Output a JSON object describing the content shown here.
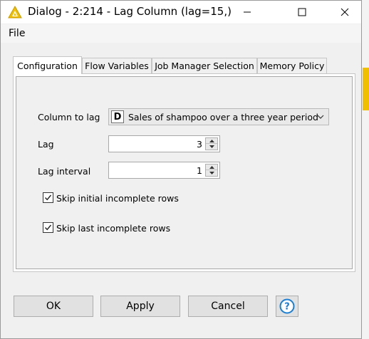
{
  "window": {
    "title": "Dialog - 2:214 - Lag Column (lag=15,)",
    "app_icon": "knime-triangle-icon",
    "accent_color": "#f0c000",
    "controls": [
      "minimize-icon",
      "maximize-icon",
      "close-icon"
    ]
  },
  "menu": {
    "file": "File"
  },
  "tabs": [
    {
      "label": "Configuration",
      "active": true
    },
    {
      "label": "Flow Variables",
      "active": false
    },
    {
      "label": "Job Manager Selection",
      "active": false
    },
    {
      "label": "Memory Policy",
      "active": false
    }
  ],
  "config": {
    "column_to_lag_label": "Column to lag",
    "column_type_badge": "D",
    "column_value": "Sales of shampoo over a three year period",
    "lag_label": "Lag",
    "lag_value": "3",
    "lag_interval_label": "Lag interval",
    "lag_interval_value": "1",
    "skip_initial_label": "Skip initial incomplete rows",
    "skip_initial_checked": true,
    "skip_last_label": "Skip last incomplete rows",
    "skip_last_checked": true
  },
  "buttons": {
    "ok": "OK",
    "apply": "Apply",
    "cancel": "Cancel",
    "help_icon": "help-icon"
  }
}
